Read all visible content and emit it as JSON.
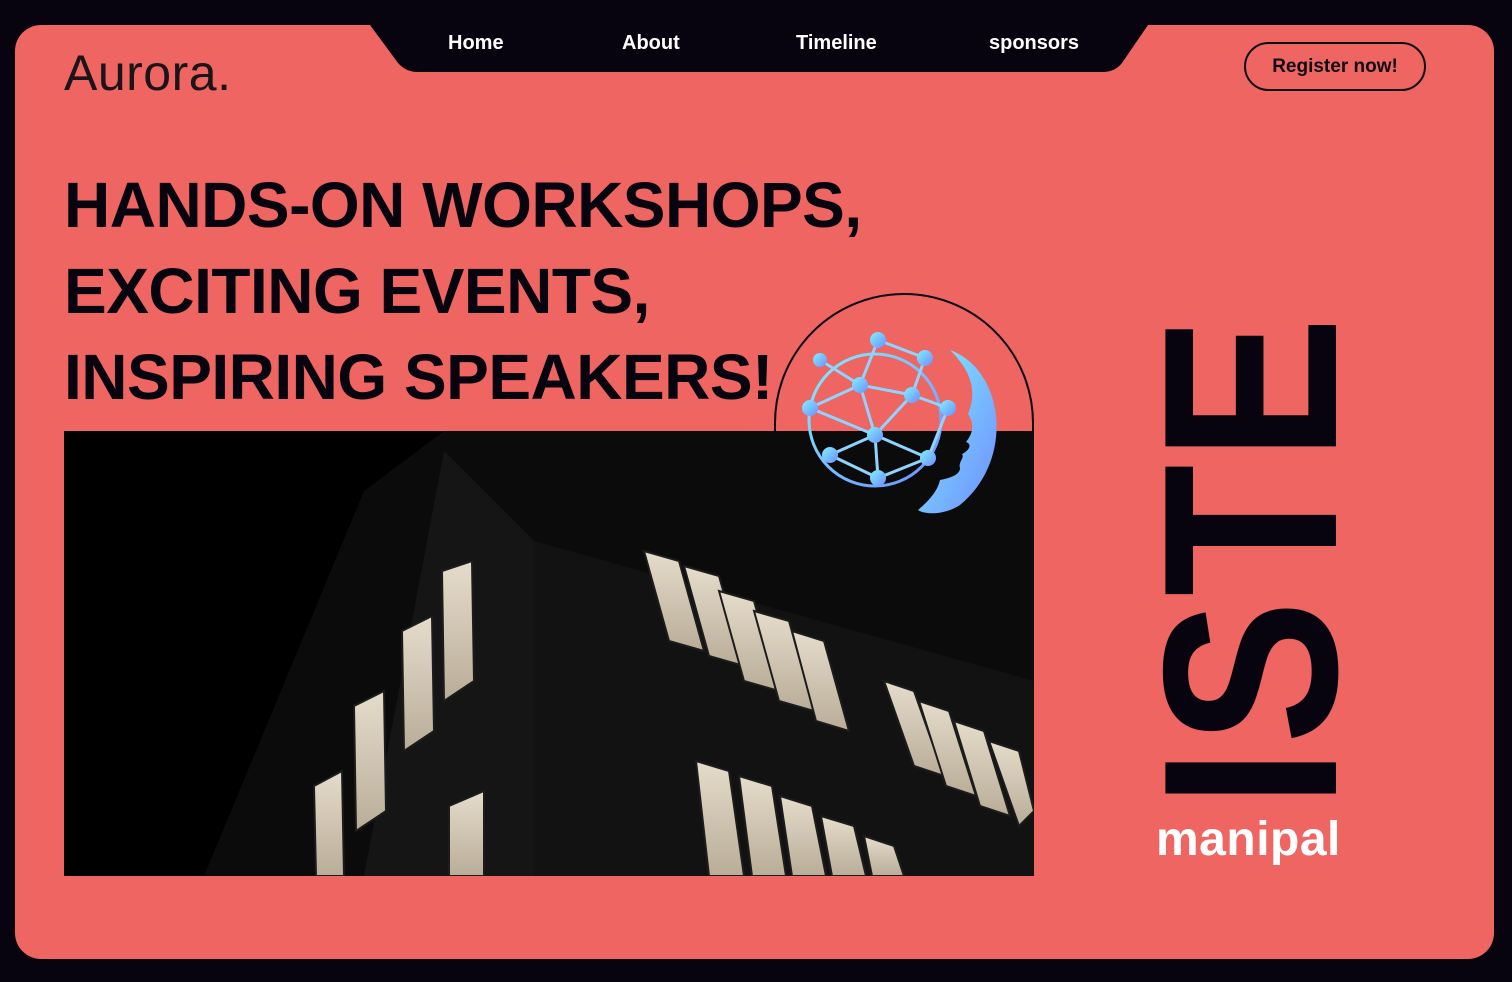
{
  "brand": {
    "logo_text": "Aurora."
  },
  "nav": {
    "items": [
      {
        "label": "Home"
      },
      {
        "label": "About"
      },
      {
        "label": "Timeline"
      },
      {
        "label": "sponsors"
      }
    ]
  },
  "cta": {
    "register_label": "Register now!"
  },
  "hero": {
    "lines": [
      "HANDS-ON WORKSHOPS,",
      "EXCITING EVENTS,",
      "INSPIRING SPEAKERS!"
    ]
  },
  "side_logo": {
    "word": "ISTE",
    "subtitle": "manipal"
  },
  "icons": {
    "emblem": "brain-network-face-icon"
  },
  "colors": {
    "background": "#07040f",
    "card": "#ee6561",
    "text_dark": "#07040f",
    "nav_text": "#ffffff",
    "emblem_gradient_start": "#7ff2ff",
    "emblem_gradient_end": "#6f8cff"
  }
}
